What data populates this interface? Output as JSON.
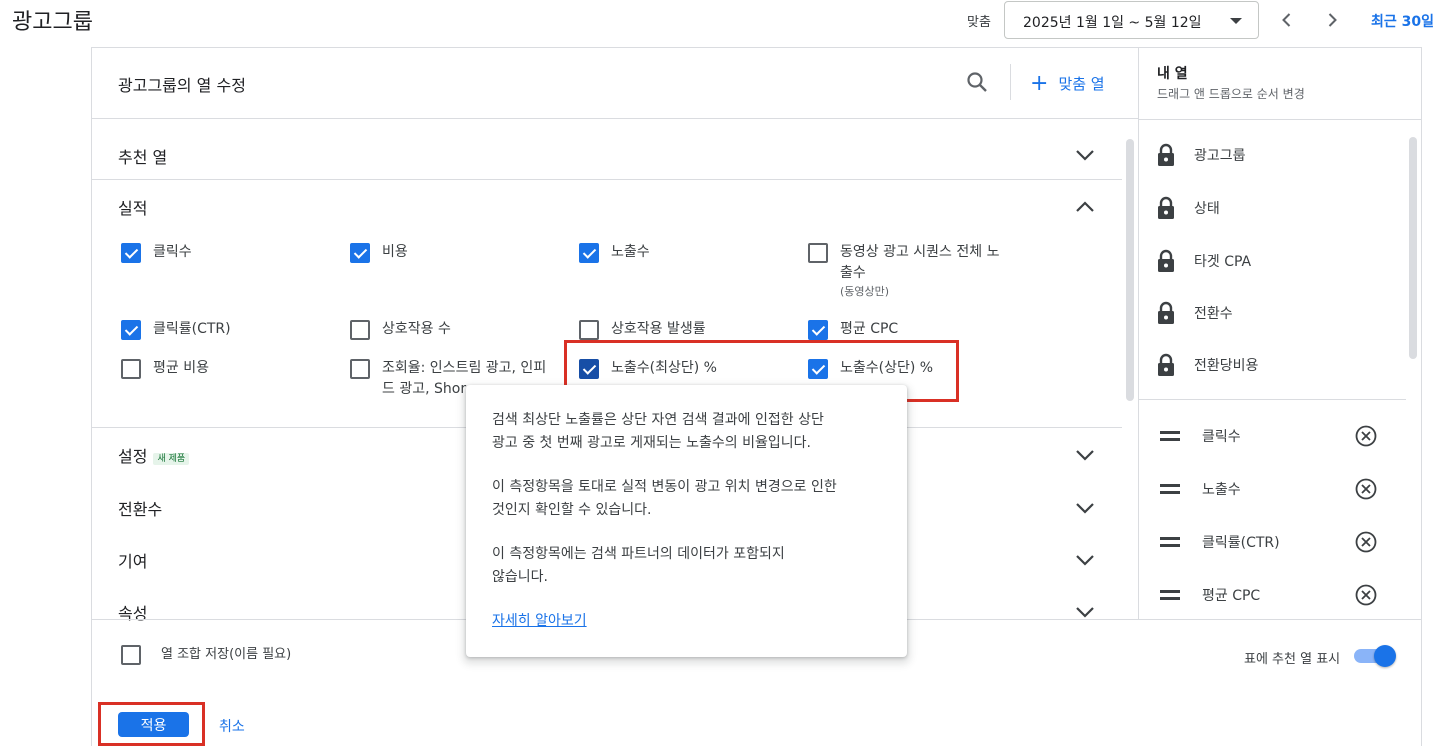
{
  "header": {
    "title": "광고그룹",
    "fit_label": "맞춤",
    "date_range": "2025년 1월 1일 ~ 5월 12일",
    "recent": "최근 30일"
  },
  "modal": {
    "title": "광고그룹의 열 수정",
    "custom_column": "맞춤 열"
  },
  "sections": {
    "recommended": "추천 열",
    "performance": "실적",
    "settings": "설정",
    "settings_badge": "새 제품",
    "conversions": "전환수",
    "attribution": "기여",
    "attributes": "속성"
  },
  "metrics": {
    "clicks": {
      "label": "클릭수",
      "checked": true
    },
    "cost": {
      "label": "비용",
      "checked": true
    },
    "impressions": {
      "label": "노출수",
      "checked": true
    },
    "video_full": {
      "label": "동영상 광고 시퀀스 전체 노출수",
      "line1": "동영상 광고 시퀀스 전체 노",
      "line2": "출수",
      "sub": "(동영상만)",
      "checked": false
    },
    "ctr": {
      "label": "클릭률(CTR)",
      "checked": true
    },
    "interactions": {
      "label": "상호작용 수",
      "checked": false
    },
    "interaction_rate": {
      "label": "상호작용 발생률",
      "checked": false
    },
    "avg_cpc": {
      "label": "평균 CPC",
      "checked": true
    },
    "avg_cost": {
      "label": "평균 비용",
      "checked": false
    },
    "view_rate": {
      "line1": "조회율: 인스트림 광고, 인피",
      "line2": "드 광고, Shor",
      "checked": false
    },
    "abs_top": {
      "label": "노출수(최상단) %",
      "checked": true
    },
    "top": {
      "label": "노출수(상단) %",
      "checked": true
    }
  },
  "tooltip": {
    "p1_line1": "검색 최상단 노출률은 상단 자연 검색 결과에 인접한 상단",
    "p1_line2": "광고 중 첫 번째 광고로 게재되는 노출수의 비율입니다.",
    "p2_line1": "이 측정항목을 토대로 실적 변동이 광고 위치 변경으로 인한",
    "p2_line2": "것인지 확인할 수 있습니다.",
    "p3_line1": "이 측정항목에는 검색 파트너의 데이터가 포함되지",
    "p3_line2": "않습니다.",
    "link": "자세히 알아보기"
  },
  "my_columns": {
    "title": "내 열",
    "subtitle": "드래그 앤 드롭으로 순서 변경",
    "locked": [
      "광고그룹",
      "상태",
      "타겟 CPA",
      "전환수",
      "전환당비용"
    ],
    "draggable": [
      "클릭수",
      "노출수",
      "클릭률(CTR)",
      "평균 CPC"
    ]
  },
  "footer": {
    "save_combo": "열 조합 저장(이름 필요)",
    "show_recommended": "표에 추천 열 표시",
    "apply": "적용",
    "cancel": "취소"
  },
  "colors": {
    "accent": "#1a73e8",
    "highlight": "#d93025"
  }
}
